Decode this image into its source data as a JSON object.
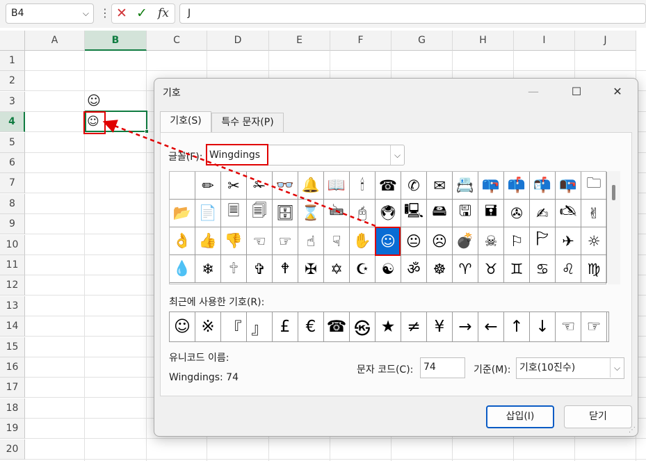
{
  "formula_bar": {
    "name_box": "B4",
    "cancel_icon": "✕",
    "enter_icon": "✓",
    "function_icon": "fx",
    "content": "J"
  },
  "sheet": {
    "columns": [
      "A",
      "B",
      "C",
      "D",
      "E",
      "F",
      "G",
      "H",
      "I",
      "J"
    ],
    "rows": [
      "1",
      "2",
      "3",
      "4",
      "5",
      "6",
      "7",
      "8",
      "9",
      "10",
      "11",
      "12",
      "13",
      "14",
      "15",
      "16",
      "17",
      "18",
      "19",
      "20"
    ],
    "selected_column": "B",
    "selected_row": "4",
    "cells": {
      "B3": "☺",
      "B4": "☺"
    }
  },
  "dialog": {
    "title": "기호",
    "minimize": "—",
    "maximize": "☐",
    "close": "✕",
    "tabs": [
      "기호(S)",
      "특수 문자(P)"
    ],
    "font_label": "글꼴(F):",
    "font_value": "Wingdings",
    "symbols": [
      [
        "",
        "✏",
        "✂",
        "✁",
        "👓",
        "🔔",
        "📖",
        "🕯",
        "☎",
        "✆",
        "✉",
        "📇",
        "📪",
        "📫",
        "📬",
        "📭",
        "🗀"
      ],
      [
        "📂",
        "📄",
        "🗏",
        "🗐",
        "🗄",
        "⌛",
        "🖮",
        "🖰",
        "🖲",
        "🖳",
        "🖴",
        "🖫",
        "🖬",
        "✇",
        "✍",
        "🖎",
        "✌"
      ],
      [
        "👌",
        "👍",
        "👎",
        "☜",
        "☞",
        "☝",
        "☟",
        "✋",
        "☺",
        "😐",
        "☹",
        "💣",
        "☠",
        "⚐",
        "🏱",
        "✈",
        "☼"
      ],
      [
        "💧",
        "❄",
        "🕆",
        "✞",
        "🕈",
        "✠",
        "✡",
        "☪",
        "☯",
        "ॐ",
        "☸",
        "♈",
        "♉",
        "♊",
        "♋",
        "♌",
        "♍"
      ]
    ],
    "selected_symbol": "☺",
    "recent_label": "최근에 사용한 기호(R):",
    "recent_symbols": [
      "☺",
      "※",
      "『",
      "』",
      "£",
      "€",
      "☎",
      "㉿",
      "★",
      "≠",
      "¥",
      "→",
      "←",
      "↑",
      "↓",
      "☜",
      "☞"
    ],
    "unicode_name_label": "유니코드 이름:",
    "unicode_name_value": "Wingdings: 74",
    "char_code_label": "문자 코드(C):",
    "char_code_value": "74",
    "base_label": "기준(M):",
    "base_value": "기호(10진수)",
    "insert_button": "삽입(I)",
    "close_button": "닫기"
  },
  "colors": {
    "excel_green": "#107c41",
    "highlight_red": "#e00000",
    "selection_blue": "#0a6cd4"
  }
}
